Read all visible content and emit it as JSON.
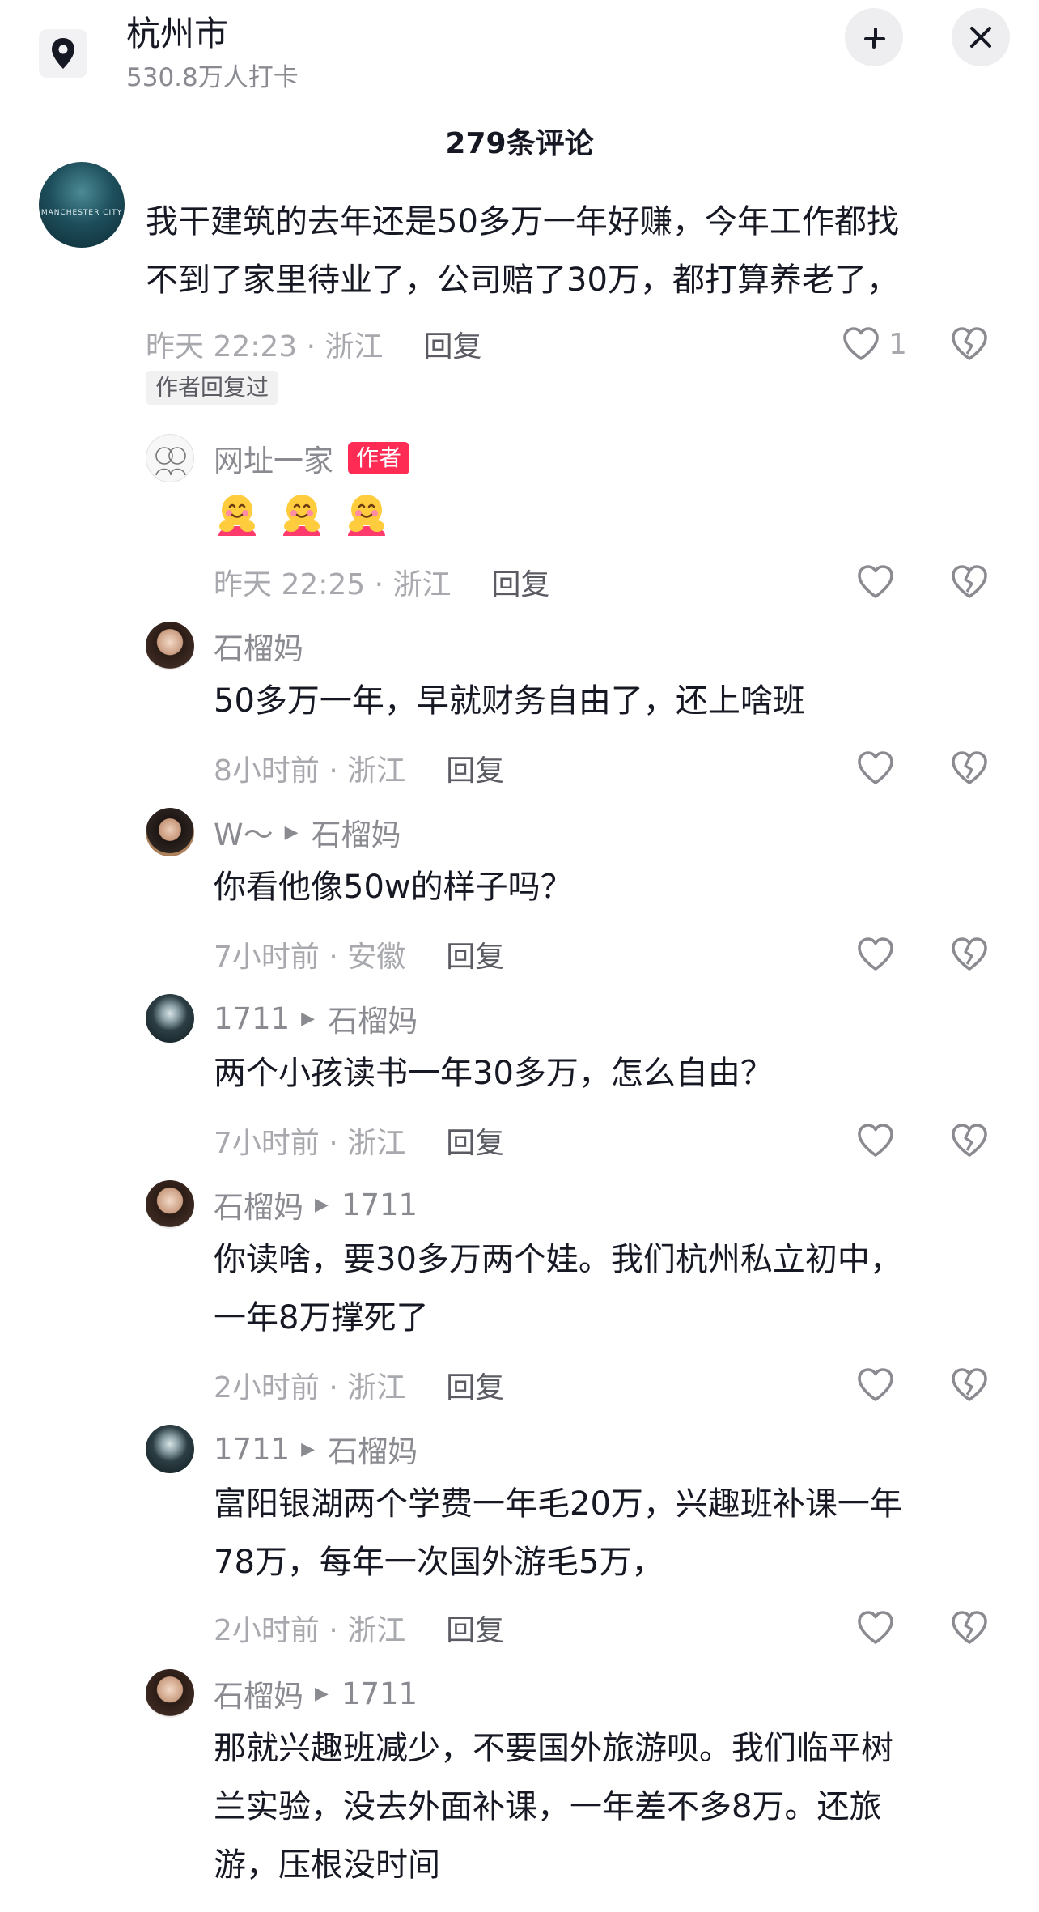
{
  "location": {
    "title": "杭州市",
    "checkins": "530.8万人打卡"
  },
  "comment_count": "279条评论",
  "root_comment": {
    "text_line1": "我干建筑的去年还是50多万一年好赚，今年工作都找",
    "text_line2": "不到了家里待业了，公司赔了30万，都打算养老了，",
    "time": "昨天 22:23 · 浙江",
    "reply_label": "回复",
    "likes": "1",
    "author_replied_chip": "作者回复过",
    "avatar_caption": "MANCHESTER CITY"
  },
  "replies": [
    {
      "user": "网址一家",
      "tag": "作者",
      "reply_to": "",
      "emojis": [
        "🥰",
        "🥰",
        "🥰"
      ],
      "lines": [],
      "time": "昨天 22:25 · 浙江",
      "reply_label": "回复"
    },
    {
      "user": "石榴妈",
      "reply_to": "",
      "lines": [
        "50多万一年，早就财务自由了，还上啥班"
      ],
      "time": "8小时前 · 浙江",
      "reply_label": "回复"
    },
    {
      "user": "W～",
      "reply_to": "石榴妈",
      "lines": [
        "你看他像50w的样子吗？"
      ],
      "time": "7小时前 · 安徽",
      "reply_label": "回复"
    },
    {
      "user": "1711",
      "reply_to": "石榴妈",
      "lines": [
        "两个小孩读书一年30多万，怎么自由？"
      ],
      "time": "7小时前 · 浙江",
      "reply_label": "回复"
    },
    {
      "user": "石榴妈",
      "reply_to": "1711",
      "lines": [
        "你读啥，要30多万两个娃。我们杭州私立初中，",
        "一年8万撑死了"
      ],
      "time": "2小时前 · 浙江",
      "reply_label": "回复"
    },
    {
      "user": "1711",
      "reply_to": "石榴妈",
      "lines": [
        "富阳银湖两个学费一年毛20万，兴趣班补课一年",
        "78万，每年一次国外游毛5万，"
      ],
      "time": "2小时前 · 浙江",
      "reply_label": "回复"
    },
    {
      "user": "石榴妈",
      "reply_to": "1711",
      "lines": [
        "那就兴趣班减少，不要国外旅游呗。我们临平树",
        "兰实验，没去外面补课，一年差不多8万。还旅",
        "游，压根没时间"
      ],
      "time": "",
      "reply_label": ""
    }
  ],
  "icons": {
    "location": "location-pin-icon",
    "minimize": "minimize-icon",
    "close": "close-icon",
    "like": "heart-outline-icon",
    "dislike": "broken-heart-icon",
    "reply_arrow": "triangle-right-icon"
  },
  "colors": {
    "author_tag": "#fe2c55",
    "muted": "#8a8b91",
    "text": "#161823"
  }
}
